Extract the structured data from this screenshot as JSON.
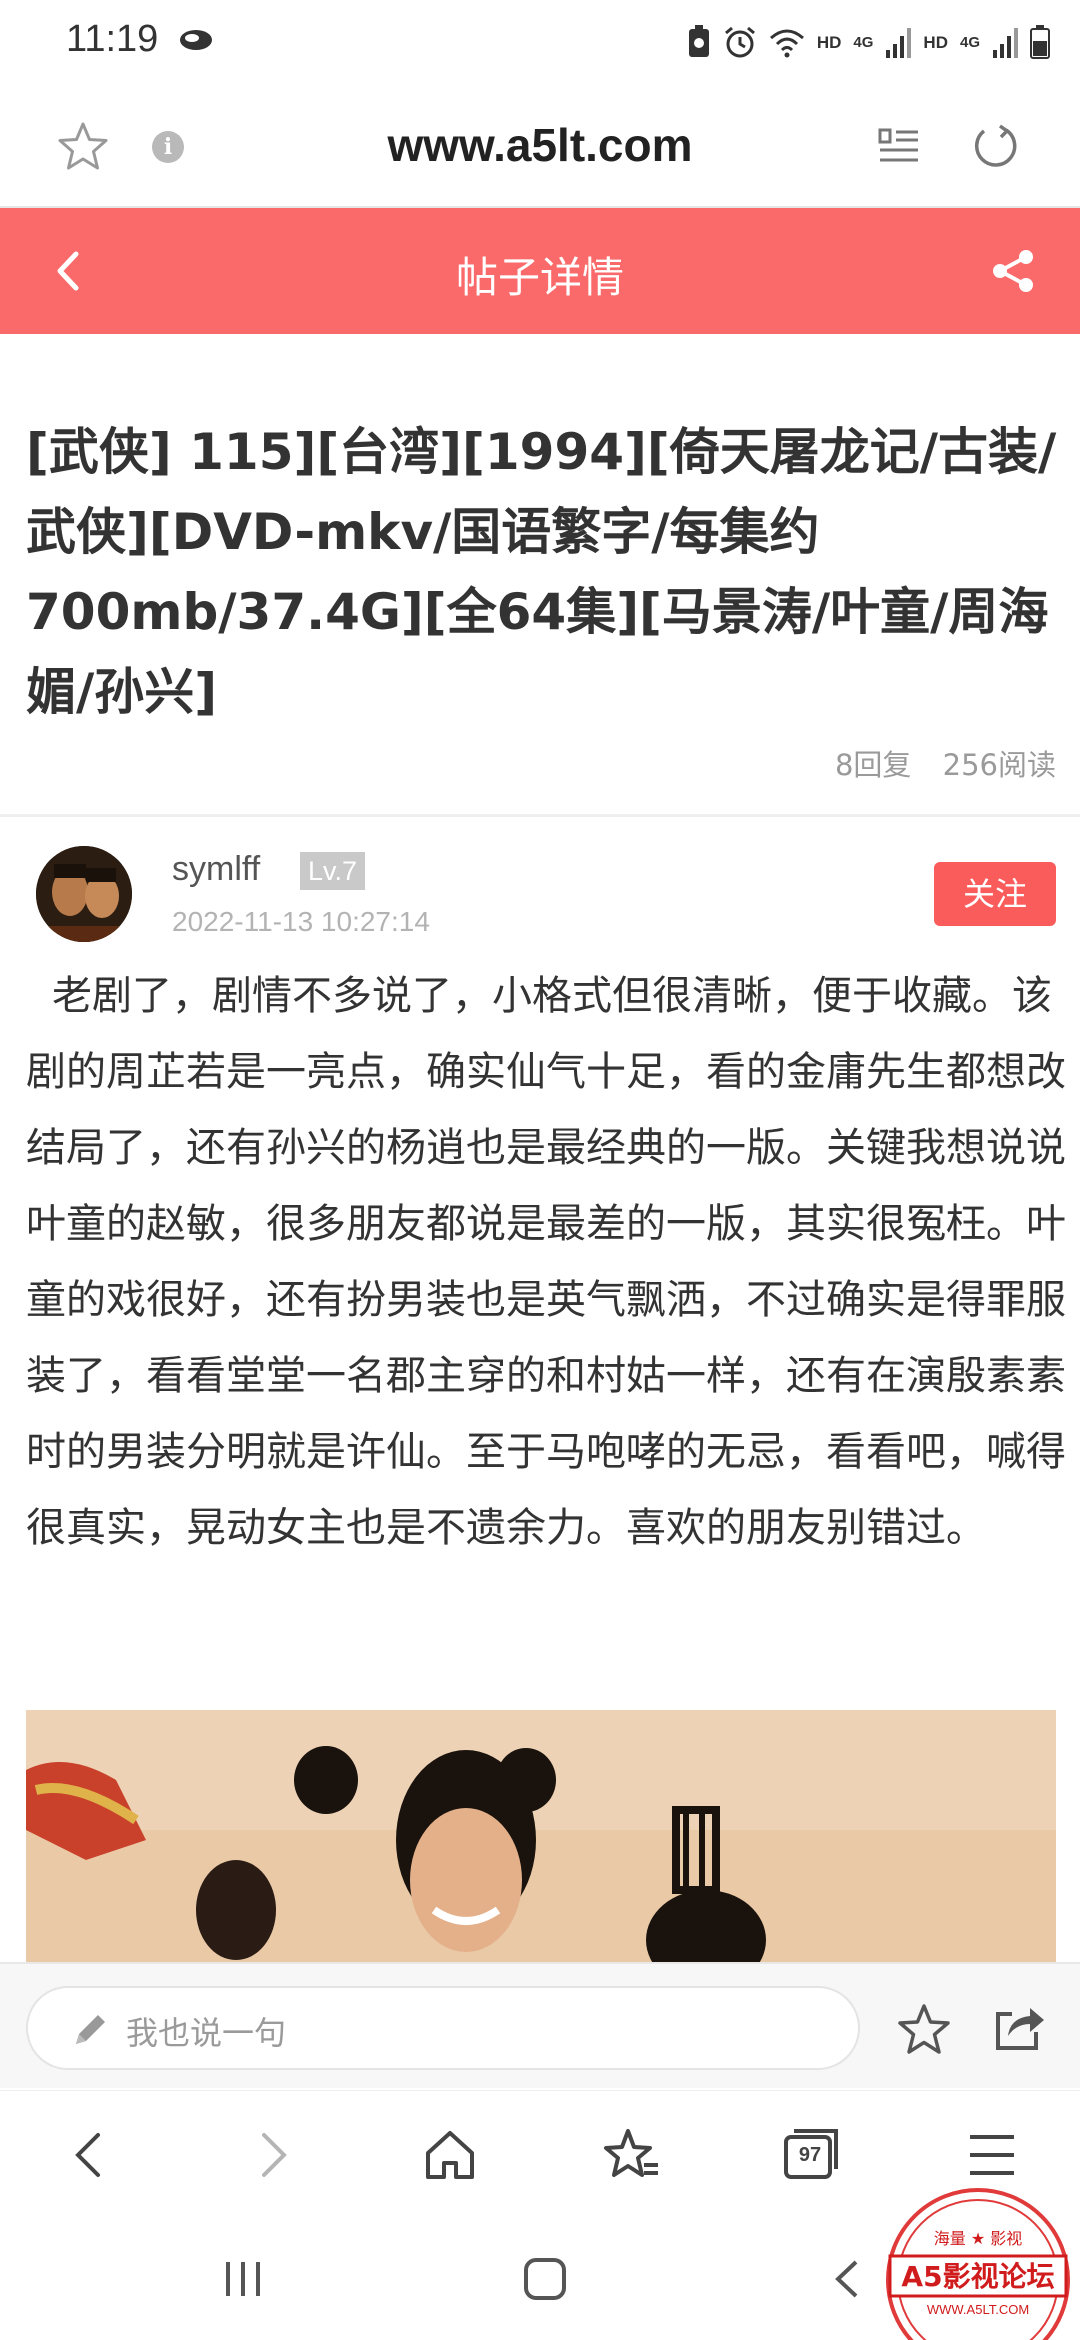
{
  "status_bar": {
    "time": "11:19",
    "hd1": "HD",
    "net1": "4G",
    "hd2": "HD",
    "net2": "4G",
    "icons": [
      "cloud-icon",
      "battery-saver-icon",
      "alarm-icon",
      "wifi-icon",
      "signal-icon",
      "signal-icon",
      "battery-icon"
    ]
  },
  "browser": {
    "url": "www.a5lt.com",
    "tab_count": "97"
  },
  "header": {
    "title": "帖子详情"
  },
  "post": {
    "title": "[武侠] 115][台湾][1994][倚天屠龙记/古装/武侠][DVD-mkv/国语繁字/每集约700mb/37.4G][全64集][马景涛/叶童/周海媚/孙兴]",
    "replies": "8回复",
    "views": "256阅读",
    "author": {
      "name": "symlff",
      "level": "Lv.7",
      "date": "2022-11-13 10:27:14",
      "follow_label": "关注"
    },
    "body": "老剧了，剧情不多说了，小格式但很清晰，便于收藏。该剧的周芷若是一亮点，确实仙气十足，看的金庸先生都想改结局了，还有孙兴的杨逍也是最经典的一版。关键我想说说叶童的赵敏，很多朋友都说是最差的一版，其实很冤枉。叶童的戏很好，还有扮男装也是英气飘洒，不过确实是得罪服装了，看看堂堂一名郡主穿的和村姑一样，还有在演殷素素时的男装分明就是许仙。至于马咆哮的无忌，看看吧，喊得很真实，晃动女主也是不遗余力。喜欢的朋友别错过。"
  },
  "reply_bar": {
    "placeholder": "我也说一句"
  },
  "watermark": {
    "top_text": "海量 ★ 影视",
    "brand": "A5影视论坛",
    "site": "WWW.A5LT.COM"
  },
  "colors": {
    "accent": "#fa6a6a",
    "follow": "#fa5b5b"
  }
}
